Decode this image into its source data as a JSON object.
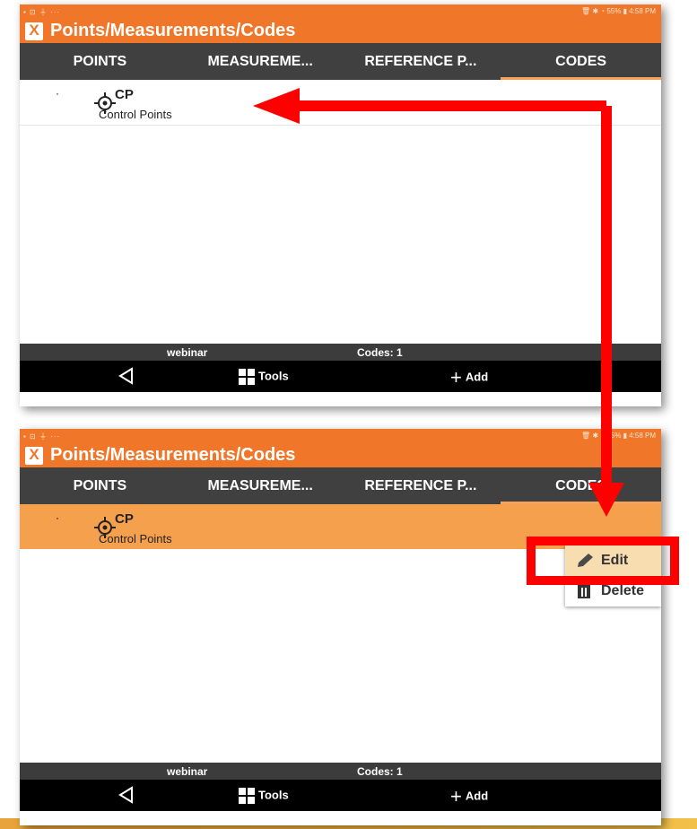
{
  "statusbar": {
    "left": "▪ ⊡ ⏚ ···",
    "right": "🗑 ✱ ◔ 55% ▮ 4:58 PM"
  },
  "app": {
    "title": "Points/Measurements/Codes",
    "logo_icon": "x-logo-icon"
  },
  "tabs": [
    {
      "label": "POINTS"
    },
    {
      "label": "MEASUREME..."
    },
    {
      "label": "REFERENCE P..."
    },
    {
      "label": "CODES",
      "active": true
    }
  ],
  "codes": [
    {
      "dot": "·",
      "name": "CP",
      "description": "Control Points",
      "icon": "crosshair-icon"
    }
  ],
  "footer": {
    "project": "webinar",
    "count": "Codes: 1"
  },
  "nav": {
    "tools": "Tools",
    "add": "Add"
  },
  "context_menu": {
    "edit": "Edit",
    "delete": "Delete"
  },
  "colors": {
    "accent": "#f0772a",
    "selected_row": "#f5a04d",
    "annotation": "#ff0000"
  }
}
